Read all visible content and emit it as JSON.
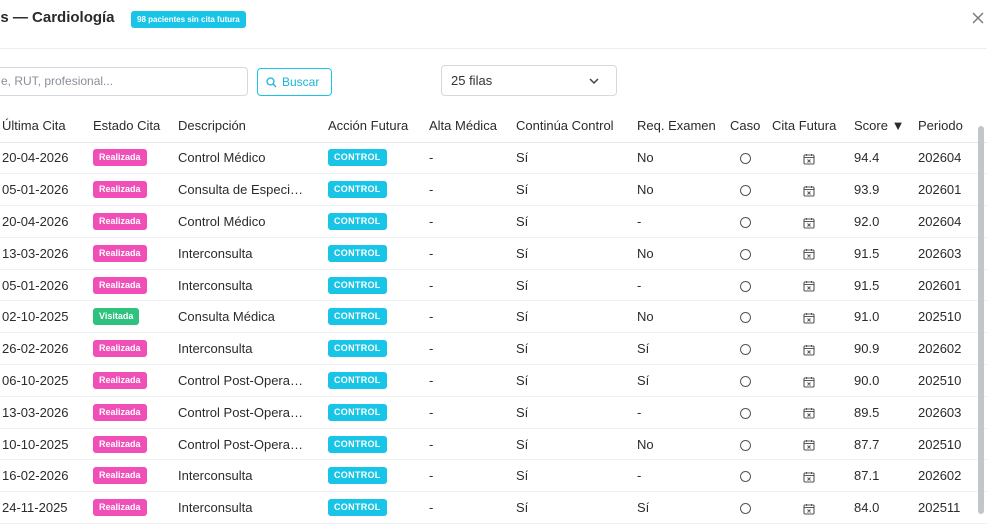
{
  "header": {
    "title": "es — Cardiología",
    "badge": "98 pacientes sin cita futura",
    "close_icon": "close-icon"
  },
  "toolbar": {
    "search_placeholder": "e, RUT, profesional...",
    "search_button": "Buscar",
    "page_size": "25 filas"
  },
  "colors": {
    "accent": "#18c5e6",
    "realizada": "#f04fb8",
    "visitada": "#2ec27e"
  },
  "table": {
    "columns": [
      "Última Cita",
      "Estado Cita",
      "Descripción",
      "Acción Futura",
      "Alta Médica",
      "Continúa Control",
      "Req. Examen",
      "Caso",
      "Cita Futura",
      "Score ▼",
      "Periodo"
    ],
    "rows": [
      {
        "fecha": "20-04-2026",
        "estado": "Realizada",
        "desc": "Control Médico",
        "accion": "CONTROL",
        "alta": "-",
        "continua": "Sí",
        "examen": "No",
        "score": "94.4",
        "periodo": "202604"
      },
      {
        "fecha": "05-01-2026",
        "estado": "Realizada",
        "desc": "Consulta de Especi…",
        "accion": "CONTROL",
        "alta": "-",
        "continua": "Sí",
        "examen": "No",
        "score": "93.9",
        "periodo": "202601"
      },
      {
        "fecha": "20-04-2026",
        "estado": "Realizada",
        "desc": "Control Médico",
        "accion": "CONTROL",
        "alta": "-",
        "continua": "Sí",
        "examen": "-",
        "score": "92.0",
        "periodo": "202604"
      },
      {
        "fecha": "13-03-2026",
        "estado": "Realizada",
        "desc": "Interconsulta",
        "accion": "CONTROL",
        "alta": "-",
        "continua": "Sí",
        "examen": "No",
        "score": "91.5",
        "periodo": "202603"
      },
      {
        "fecha": "05-01-2026",
        "estado": "Realizada",
        "desc": "Interconsulta",
        "accion": "CONTROL",
        "alta": "-",
        "continua": "Sí",
        "examen": "-",
        "score": "91.5",
        "periodo": "202601"
      },
      {
        "fecha": "02-10-2025",
        "estado": "Visitada",
        "desc": "Consulta Médica",
        "accion": "CONTROL",
        "alta": "-",
        "continua": "Sí",
        "examen": "No",
        "score": "91.0",
        "periodo": "202510"
      },
      {
        "fecha": "26-02-2026",
        "estado": "Realizada",
        "desc": "Interconsulta",
        "accion": "CONTROL",
        "alta": "-",
        "continua": "Sí",
        "examen": "Sí",
        "score": "90.9",
        "periodo": "202602"
      },
      {
        "fecha": "06-10-2025",
        "estado": "Realizada",
        "desc": "Control Post-Opera…",
        "accion": "CONTROL",
        "alta": "-",
        "continua": "Sí",
        "examen": "Sí",
        "score": "90.0",
        "periodo": "202510"
      },
      {
        "fecha": "13-03-2026",
        "estado": "Realizada",
        "desc": "Control Post-Opera…",
        "accion": "CONTROL",
        "alta": "-",
        "continua": "Sí",
        "examen": "-",
        "score": "89.5",
        "periodo": "202603"
      },
      {
        "fecha": "10-10-2025",
        "estado": "Realizada",
        "desc": "Control Post-Opera…",
        "accion": "CONTROL",
        "alta": "-",
        "continua": "Sí",
        "examen": "No",
        "score": "87.7",
        "periodo": "202510"
      },
      {
        "fecha": "16-02-2026",
        "estado": "Realizada",
        "desc": "Interconsulta",
        "accion": "CONTROL",
        "alta": "-",
        "continua": "Sí",
        "examen": "-",
        "score": "87.1",
        "periodo": "202602"
      },
      {
        "fecha": "24-11-2025",
        "estado": "Realizada",
        "desc": "Interconsulta",
        "accion": "CONTROL",
        "alta": "-",
        "continua": "Sí",
        "examen": "Sí",
        "score": "84.0",
        "periodo": "202511"
      }
    ]
  }
}
